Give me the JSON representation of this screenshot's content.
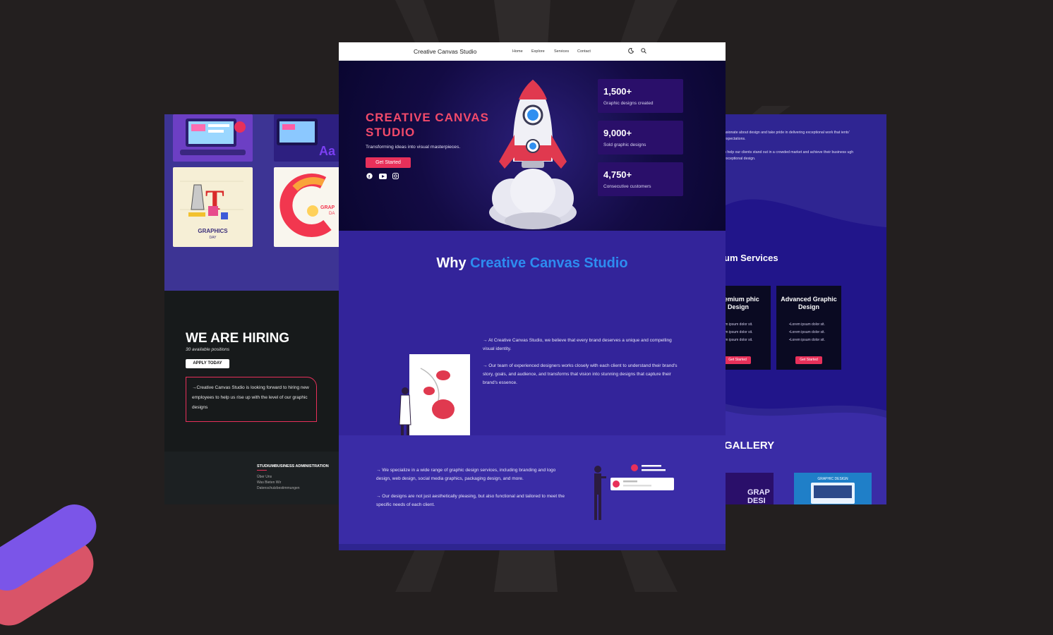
{
  "colors": {
    "background": "#231f1f",
    "accent_red": "#e8305a",
    "accent_blue": "#2d8cf0",
    "purple": "#3a2ea2",
    "dark_navy": "#0a0630"
  },
  "left_preview": {
    "thumb1_text": "GRAPHICS",
    "thumb1_sub": "DAY",
    "thumb2_text": "GRAP",
    "thumb2_sub": "DA",
    "hiring_title": "WE ARE HIRING",
    "hiring_sub": "30 available positions",
    "apply_label": "APPLY TODAY",
    "hiring_text": "→Creative Canvas Studio is looking forward to hiring new employees to help us rise up with the level of our graphic designs",
    "footer_heading": "STUDIUMBUSINESS ADMINISTRATION",
    "footer_links": [
      "Über Uns",
      "Was Bieten Wir",
      "Datenschutzbestimmungen"
    ]
  },
  "center_page": {
    "nav": {
      "brand": "Creative Canvas Studio",
      "links": [
        "Home",
        "Explore",
        "Services",
        "Contact"
      ],
      "icons": [
        "moon-icon",
        "search-icon"
      ]
    },
    "hero": {
      "title_line1": "CREATIVE CANVAS",
      "title_line2": "STUDIO",
      "tagline": "Transforming ideas into visual masterpieces.",
      "cta": "Get Started",
      "social_icons": [
        "facebook-icon",
        "youtube-icon",
        "instagram-icon"
      ],
      "stats": [
        {
          "value": "1,500+",
          "label": "Graphic designs created"
        },
        {
          "value": "9,000+",
          "label": "Sold graphic designs"
        },
        {
          "value": "4,750+",
          "label": "Consecutive customers"
        }
      ]
    },
    "why": {
      "heading_plain": "Why",
      "heading_accent": "Creative Canvas Studio",
      "paragraphs": [
        "→ At Creative Canvas Studio, we believe that every brand deserves a unique and compelling visual identity.",
        "→ Our team of experienced designers works closely with each client to understand their brand's story, goals, and audience, and transforms that vision into stunning designs that capture their brand's essence."
      ]
    },
    "services": {
      "paragraphs": [
        "→ We specialize in a wide range of graphic design services, including branding and logo design, web design, social media graphics, packaging design, and more.",
        "→ Our designs are not just aesthetically pleasing, but also functional and tailored to meet the specific needs of each client."
      ]
    }
  },
  "right_preview": {
    "text1": "asionate about design and take pride in delivering exceptional work that ients' expectations.",
    "text2": "o help our clients stand out in a crowded market and achieve their business ugh exceptional design.",
    "services_heading": "um Services",
    "cards": [
      {
        "title": "Premium phic Design",
        "items": [
          "ım ipsum dolor sit.",
          "ım ipsum dolor sit.",
          "ım ipsum dolor sit."
        ],
        "button": "Get Started"
      },
      {
        "title": "Advanced Graphic Design",
        "items": [
          "•Lorem ipsum dolor sit.",
          "•Lorem ipsum dolor sit.",
          "•Lorem ipsum dolor sit."
        ],
        "button": "Get Started"
      }
    ],
    "gallery_heading": "GALLERY",
    "gallery_thumb1": "GRAP DESI",
    "gallery_thumb2": "GRAPHIC DESIGN"
  }
}
